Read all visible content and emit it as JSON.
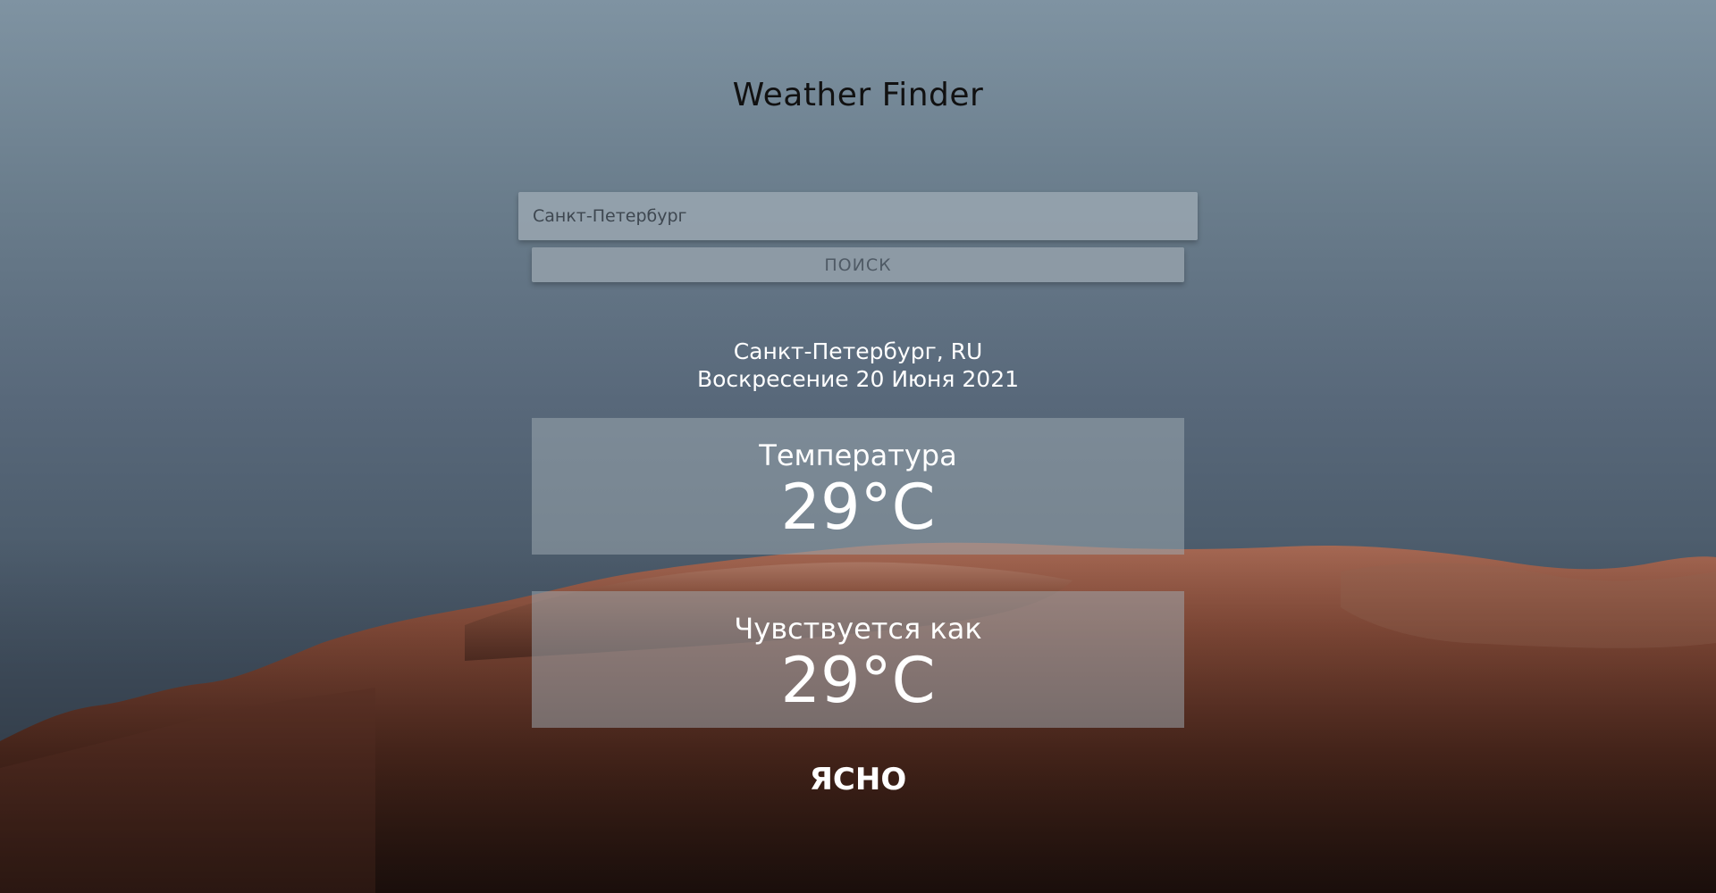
{
  "app": {
    "title": "Weather Finder"
  },
  "search": {
    "value": "Санкт-Петербург",
    "placeholder": "",
    "button_label": "ПОИСК"
  },
  "location": {
    "city": "Санкт-Петербург, RU",
    "date": "Воскресение 20 Июня 2021"
  },
  "temperature": {
    "label": "Температура",
    "value": "29°C"
  },
  "feels_like": {
    "label": "Чувствуется как",
    "value": "29°C"
  },
  "condition": {
    "text": "ЯСНО"
  },
  "colors": {
    "sky_top": "#7f93a2",
    "sky_bottom": "#475667",
    "rock": "#6e3d2c",
    "rock_light": "#a46b56",
    "text_light": "#ffffff",
    "title_text": "#111111"
  }
}
